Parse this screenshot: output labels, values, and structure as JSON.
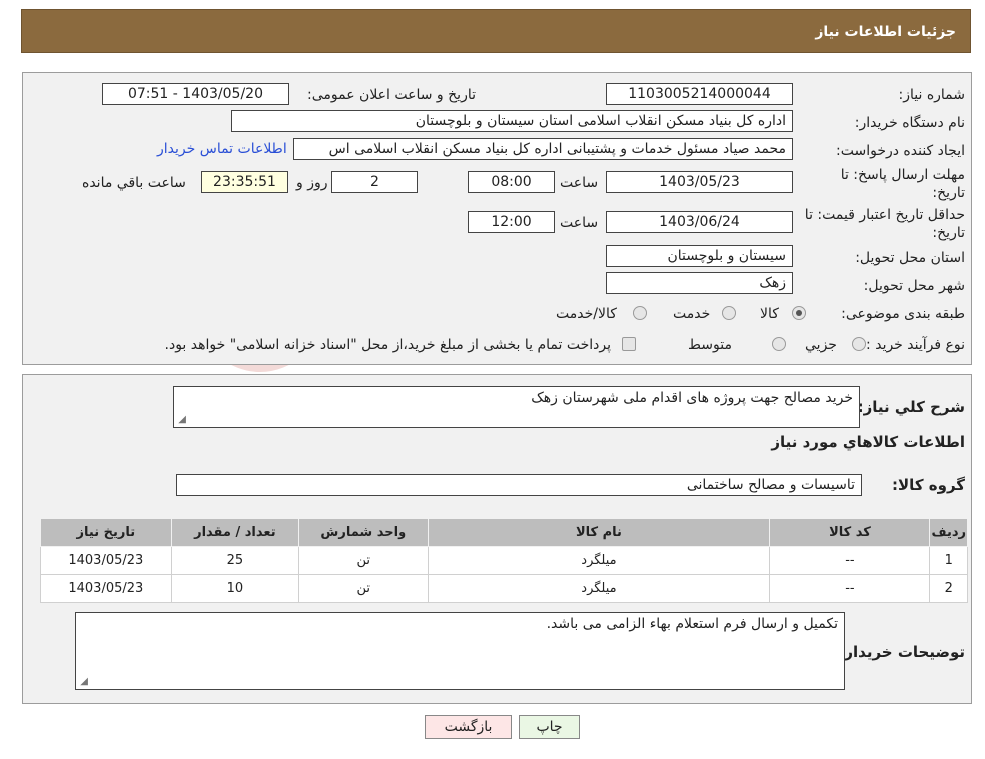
{
  "header": {
    "title": "جزئیات اطلاعات نیاز"
  },
  "fields": {
    "need_number_label": "شماره نیاز:",
    "need_number": "1103005214000044",
    "announce_label": "تاریخ و ساعت اعلان عمومی:",
    "announce_value": "1403/05/20 - 07:51",
    "buyer_label": "نام دستگاه خریدار:",
    "buyer_value": "اداره کل بنیاد مسکن انقلاب اسلامی استان سیستان و بلوچستان",
    "creator_label": "ایجاد کننده درخواست:",
    "creator_value": "محمد صیاد مسئول خدمات و پشتیبانی اداره کل بنیاد مسکن انقلاب اسلامی اس",
    "contact_link": "اطلاعات تماس خریدار",
    "deadline_label": "مهلت ارسال پاسخ: تا تاریخ:",
    "deadline_date": "1403/05/23",
    "time_word": "ساعت",
    "deadline_time": "08:00",
    "days_value": "2",
    "days_word": "روز و",
    "remaining_time": "23:35:51",
    "remaining_word": "ساعت باقي مانده",
    "validity_label": "حداقل تاریخ اعتبار قیمت: تا تاریخ:",
    "validity_date": "1403/06/24",
    "validity_time": "12:00",
    "province_label": "استان محل تحویل:",
    "province_value": "سیستان و بلوچستان",
    "city_label": "شهر محل تحویل:",
    "city_value": "زهک",
    "category_label": "طبقه بندی موضوعی:",
    "category_options": [
      "کالا",
      "خدمت",
      "کالا/خدمت"
    ],
    "process_label": "نوع فرآیند خرید :",
    "process_options": [
      "جزیي",
      "متوسط"
    ],
    "process_note": "پرداخت تمام یا بخشی از مبلغ خرید،از محل \"اسناد خزانه اسلامی\" خواهد بود."
  },
  "description": {
    "label": "شرح کلي نیاز:",
    "value": "خرید مصالح جهت پروژه های اقدام ملی شهرستان زهک"
  },
  "goods": {
    "section_title": "اطلاعات کالاهاي مورد نیاز",
    "group_label": "گروه کالا:",
    "group_value": "تاسیسات و مصالح ساختمانی",
    "columns": [
      "ردیف",
      "کد کالا",
      "نام کالا",
      "واحد شمارش",
      "تعداد / مقدار",
      "تاریخ نیاز"
    ],
    "rows": [
      [
        "1",
        "--",
        "میلگرد",
        "تن",
        "25",
        "1403/05/23"
      ],
      [
        "2",
        "--",
        "میلگرد",
        "تن",
        "10",
        "1403/05/23"
      ]
    ]
  },
  "buyer_notes": {
    "label": "توضیحات خریدار:",
    "value": "تکمیل و ارسال فرم استعلام بهاء الزامی می باشد."
  },
  "buttons": {
    "print": "چاپ",
    "back": "بازگشت"
  },
  "colors": {
    "header_bg": "#8b6a3e",
    "panel_bg": "#f1f1f1",
    "back_btn_bg": "#fde6e6",
    "print_btn_bg": "#eaf7e4"
  }
}
